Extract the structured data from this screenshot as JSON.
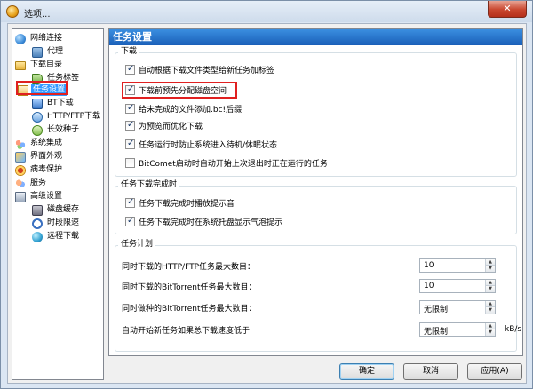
{
  "window": {
    "title": "选项...",
    "close_glyph": "✕"
  },
  "tree": {
    "items": [
      {
        "label": "网络连接",
        "icon": "globe-icon"
      },
      {
        "label": "代理",
        "icon": "proxy-icon"
      },
      {
        "label": "下载目录",
        "icon": "folder-icon"
      },
      {
        "label": "任务标签",
        "icon": "tag-icon"
      },
      {
        "label": "任务设置",
        "icon": "task-settings-icon",
        "selected": true
      },
      {
        "label": "BT下载",
        "icon": "bt-download-icon"
      },
      {
        "label": "HTTP/FTP下载",
        "icon": "http-ftp-icon"
      },
      {
        "label": "长效种子",
        "icon": "seed-icon"
      },
      {
        "label": "系统集成",
        "icon": "integration-icon"
      },
      {
        "label": "界面外观",
        "icon": "appearance-icon"
      },
      {
        "label": "病毒保护",
        "icon": "virus-protection-icon"
      },
      {
        "label": "服务",
        "icon": "service-icon"
      },
      {
        "label": "高级设置",
        "icon": "advanced-icon"
      },
      {
        "label": "磁盘缓存",
        "icon": "disk-cache-icon"
      },
      {
        "label": "时段限速",
        "icon": "time-limit-icon"
      },
      {
        "label": "远程下载",
        "icon": "remote-download-icon"
      }
    ]
  },
  "panel": {
    "header": "任务设置",
    "download_group": {
      "title": "下载",
      "options": [
        {
          "label": "自动根据下载文件类型给新任务加标签",
          "checked": true
        },
        {
          "label": "下载前预先分配磁盘空间",
          "checked": true
        },
        {
          "label": "给未完成的文件添加.bc!后缀",
          "checked": true
        },
        {
          "label": "为预览而优化下载",
          "checked": true
        },
        {
          "label": "任务运行时防止系统进入待机/休眠状态",
          "checked": true
        },
        {
          "label": "BitComet启动时自动开始上次退出时正在运行的任务",
          "checked": false
        }
      ]
    },
    "complete_group": {
      "title": "任务下载完成时",
      "options": [
        {
          "label": "任务下载完成时播放提示音",
          "checked": true
        },
        {
          "label": "任务下载完成时在系统托盘显示气泡提示",
          "checked": true
        }
      ]
    },
    "schedule_group": {
      "title": "任务计划",
      "fields": [
        {
          "label": "同时下载的HTTP/FTP任务最大数目：",
          "value": "10",
          "unit": ""
        },
        {
          "label": "同时下载的BitTorrent任务最大数目：",
          "value": "10",
          "unit": ""
        },
        {
          "label": "同时做种的BitTorrent任务最大数目：",
          "value": "无限制",
          "unit": ""
        },
        {
          "label": "自动开始新任务如果总下载速度低于:",
          "value": "无限制",
          "unit": "kB/s"
        }
      ]
    }
  },
  "buttons": {
    "ok": "确定",
    "cancel": "取消",
    "apply": "应用(A)"
  },
  "colors": {
    "header_blue": "#1a5fb8",
    "selection": "#3399ff",
    "highlight_red": "#e02020"
  }
}
